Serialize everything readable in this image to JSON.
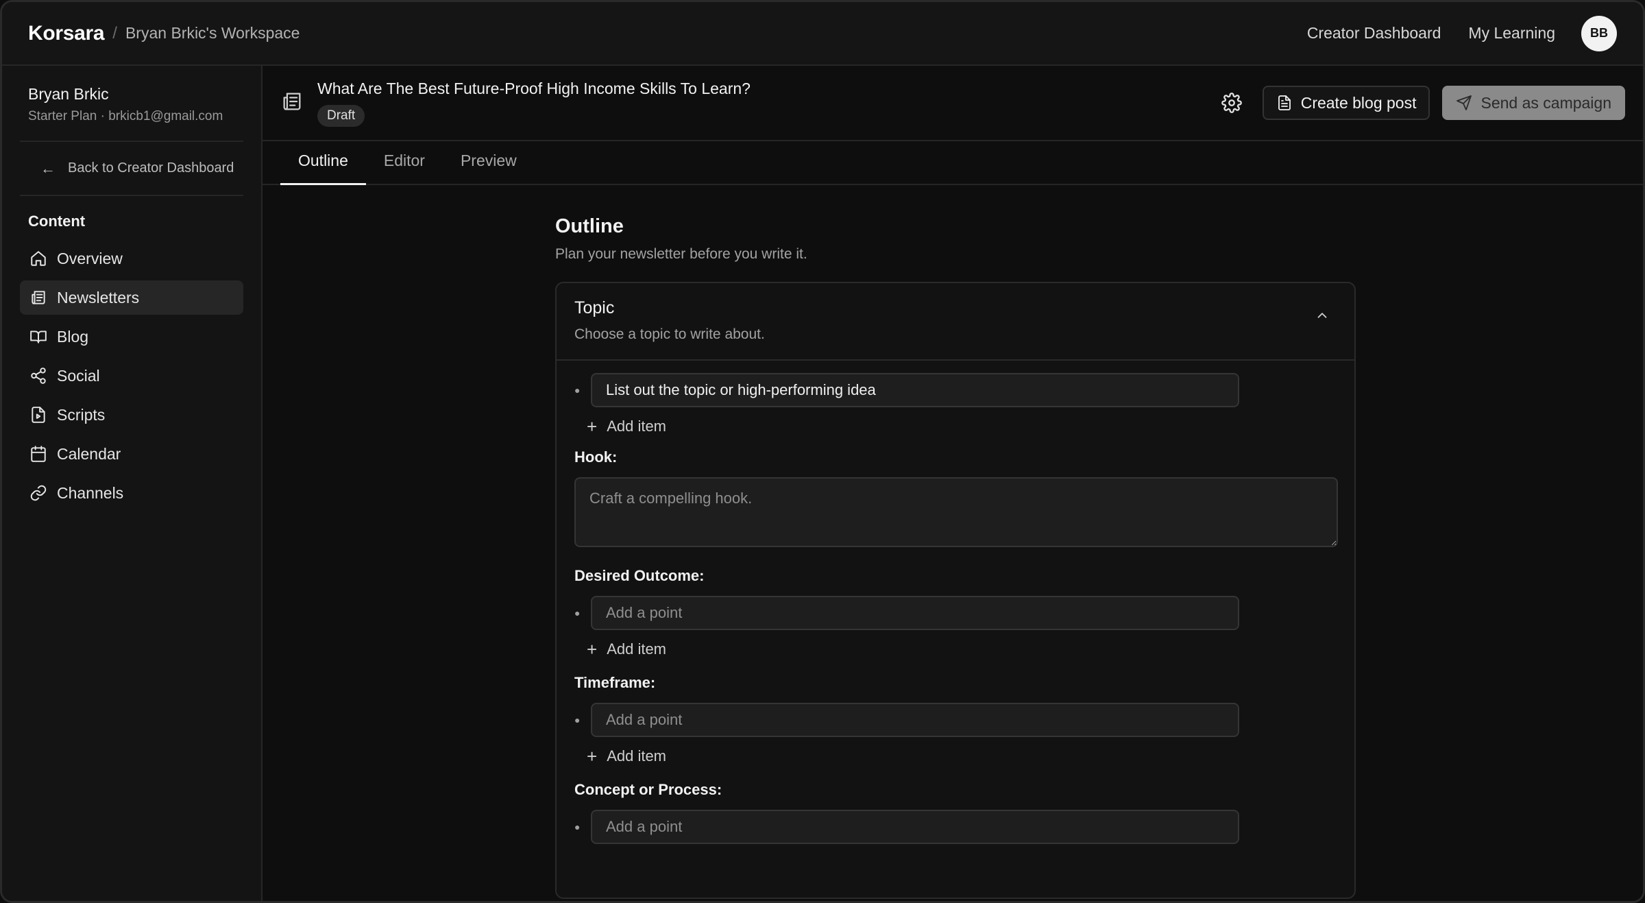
{
  "topbar": {
    "brand": "Korsara",
    "separator": "/",
    "workspace": "Bryan Brkic's Workspace",
    "links": [
      "Creator Dashboard",
      "My Learning"
    ],
    "avatar_initials": "BB"
  },
  "sidebar": {
    "user_name": "Bryan Brkic",
    "user_meta": "Starter Plan · brkicb1@gmail.com",
    "back_label": "Back to Creator Dashboard",
    "section_label": "Content",
    "items": [
      {
        "label": "Overview",
        "icon": "home-icon"
      },
      {
        "label": "Newsletters",
        "icon": "newspaper-icon",
        "active": true
      },
      {
        "label": "Blog",
        "icon": "book-icon"
      },
      {
        "label": "Social",
        "icon": "share-icon"
      },
      {
        "label": "Scripts",
        "icon": "file-video-icon"
      },
      {
        "label": "Calendar",
        "icon": "calendar-icon"
      },
      {
        "label": "Channels",
        "icon": "link-icon"
      }
    ]
  },
  "doc": {
    "title": "What Are The Best Future-Proof High Income Skills To Learn?",
    "status": "Draft",
    "create_blog_label": "Create blog post",
    "send_campaign_label": "Send as campaign"
  },
  "tabs": [
    {
      "label": "Outline",
      "active": true
    },
    {
      "label": "Editor"
    },
    {
      "label": "Preview"
    }
  ],
  "outline": {
    "title": "Outline",
    "subtitle": "Plan your newsletter before you write it.",
    "topic_title": "Topic",
    "topic_subtitle": "Choose a topic to write about.",
    "topic_item_value": "List out the topic or high-performing idea",
    "add_item_label": "Add item",
    "hook_label": "Hook:",
    "hook_placeholder": "Craft a compelling hook.",
    "desired_outcome_label": "Desired Outcome:",
    "timeframe_label": "Timeframe:",
    "concept_label": "Concept or Process:",
    "point_placeholder": "Add a point"
  },
  "colors": {
    "background": "#0e0e0e",
    "panel": "#151515",
    "border": "#262626",
    "muted_button": "#8a8a8a"
  }
}
